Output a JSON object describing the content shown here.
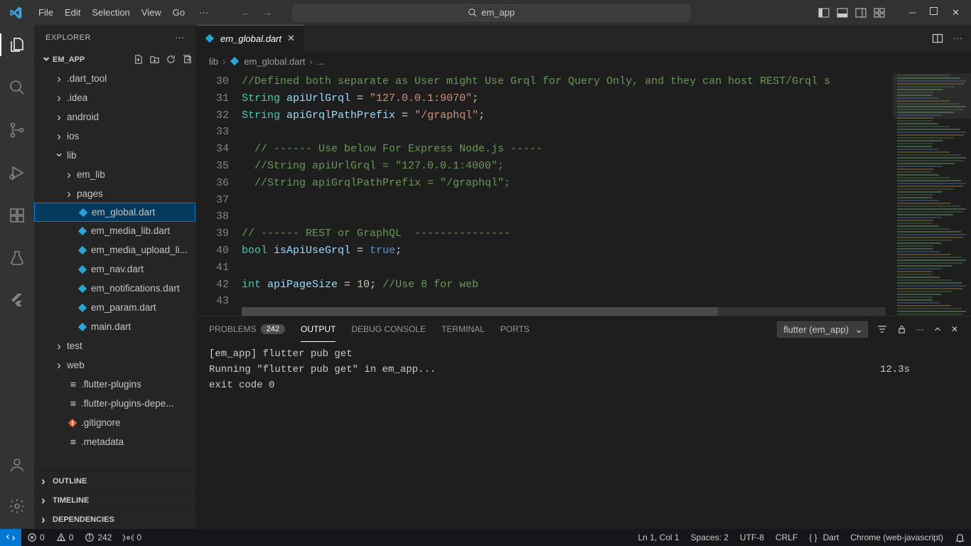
{
  "titlebar": {
    "menus": [
      "File",
      "Edit",
      "Selection",
      "View",
      "Go"
    ],
    "search_placeholder": "em_app"
  },
  "activitybar": {
    "items": [
      "files",
      "search",
      "source-control",
      "debug",
      "extensions",
      "testing",
      "flutter"
    ],
    "bottom": [
      "account",
      "settings-gear"
    ]
  },
  "sidebar": {
    "title": "EXPLORER",
    "project_name": "EM_APP",
    "tree": [
      {
        "label": ".dart_tool",
        "kind": "folder",
        "depth": 1,
        "open": false
      },
      {
        "label": ".idea",
        "kind": "folder",
        "depth": 1,
        "open": false
      },
      {
        "label": "android",
        "kind": "folder",
        "depth": 1,
        "open": false
      },
      {
        "label": "ios",
        "kind": "folder",
        "depth": 1,
        "open": false
      },
      {
        "label": "lib",
        "kind": "folder",
        "depth": 1,
        "open": true
      },
      {
        "label": "em_lib",
        "kind": "folder",
        "depth": 2,
        "open": false
      },
      {
        "label": "pages",
        "kind": "folder",
        "depth": 2,
        "open": false
      },
      {
        "label": "em_global.dart",
        "kind": "dart",
        "depth": 2,
        "selected": true
      },
      {
        "label": "em_media_lib.dart",
        "kind": "dart",
        "depth": 2
      },
      {
        "label": "em_media_upload_li...",
        "kind": "dart",
        "depth": 2
      },
      {
        "label": "em_nav.dart",
        "kind": "dart",
        "depth": 2
      },
      {
        "label": "em_notifications.dart",
        "kind": "dart",
        "depth": 2
      },
      {
        "label": "em_param.dart",
        "kind": "dart",
        "depth": 2
      },
      {
        "label": "main.dart",
        "kind": "dart",
        "depth": 2
      },
      {
        "label": "test",
        "kind": "folder",
        "depth": 1,
        "open": false
      },
      {
        "label": "web",
        "kind": "folder",
        "depth": 1,
        "open": false
      },
      {
        "label": ".flutter-plugins",
        "kind": "file",
        "depth": 1
      },
      {
        "label": ".flutter-plugins-depe...",
        "kind": "file",
        "depth": 1
      },
      {
        "label": ".gitignore",
        "kind": "git",
        "depth": 1
      },
      {
        "label": ".metadata",
        "kind": "file",
        "depth": 1
      }
    ],
    "collapsed_sections": [
      "OUTLINE",
      "TIMELINE",
      "DEPENDENCIES"
    ]
  },
  "editor": {
    "tab_label": "em_global.dart",
    "breadcrumbs": [
      "lib",
      "em_global.dart",
      "..."
    ],
    "first_line_no": 30,
    "lines": [
      {
        "n": 30,
        "segs": [
          {
            "t": "//Defined both separate as User might Use Grql for Query Only, and they can host REST/Grql s",
            "c": "tok-comment"
          }
        ]
      },
      {
        "n": 31,
        "segs": [
          {
            "t": "String ",
            "c": "tok-type"
          },
          {
            "t": "apiUrlGrql",
            "c": "tok-var"
          },
          {
            "t": " = ",
            "c": "tok-op"
          },
          {
            "t": "\"127.0.0.1:9070\"",
            "c": "tok-str"
          },
          {
            "t": ";",
            "c": "tok-op"
          }
        ]
      },
      {
        "n": 32,
        "segs": [
          {
            "t": "String ",
            "c": "tok-type"
          },
          {
            "t": "apiGrqlPathPrefix",
            "c": "tok-var"
          },
          {
            "t": " = ",
            "c": "tok-op"
          },
          {
            "t": "\"/graphql\"",
            "c": "tok-str"
          },
          {
            "t": ";",
            "c": "tok-op"
          }
        ]
      },
      {
        "n": 33,
        "segs": []
      },
      {
        "n": 34,
        "segs": [
          {
            "t": "  // ------ Use below For Express Node.js -----",
            "c": "tok-comment"
          }
        ]
      },
      {
        "n": 35,
        "segs": [
          {
            "t": "  //String apiUrlGrql = \"127.0.0.1:4000\";",
            "c": "tok-comment"
          }
        ]
      },
      {
        "n": 36,
        "segs": [
          {
            "t": "  //String apiGrqlPathPrefix = \"/graphql\";",
            "c": "tok-comment"
          }
        ]
      },
      {
        "n": 37,
        "segs": []
      },
      {
        "n": 38,
        "segs": []
      },
      {
        "n": 39,
        "segs": [
          {
            "t": "// ------ REST or GraphQL  ---------------",
            "c": "tok-comment"
          }
        ]
      },
      {
        "n": 40,
        "segs": [
          {
            "t": "bool ",
            "c": "tok-type"
          },
          {
            "t": "isApiUseGrql",
            "c": "tok-var"
          },
          {
            "t": " = ",
            "c": "tok-op"
          },
          {
            "t": "true",
            "c": "tok-keyword"
          },
          {
            "t": ";",
            "c": "tok-op"
          }
        ]
      },
      {
        "n": 41,
        "segs": []
      },
      {
        "n": 42,
        "segs": [
          {
            "t": "int ",
            "c": "tok-type"
          },
          {
            "t": "apiPageSize",
            "c": "tok-var"
          },
          {
            "t": " = ",
            "c": "tok-op"
          },
          {
            "t": "10",
            "c": "tok-num"
          },
          {
            "t": "; ",
            "c": "tok-op"
          },
          {
            "t": "//Use 8 for web",
            "c": "tok-comment"
          }
        ]
      },
      {
        "n": 43,
        "segs": []
      }
    ]
  },
  "panel": {
    "tabs": {
      "problems": "PROBLEMS",
      "problems_badge": "242",
      "output": "OUTPUT",
      "debug": "DEBUG CONSOLE",
      "terminal": "TERMINAL",
      "ports": "PORTS"
    },
    "dropdown": "flutter (em_app)",
    "output_lines": [
      {
        "lhs": "[em_app] flutter pub get",
        "rhs": ""
      },
      {
        "lhs": "Running \"flutter pub get\" in em_app...",
        "rhs": "12.3s"
      },
      {
        "lhs": "exit code 0",
        "rhs": ""
      }
    ]
  },
  "statusbar": {
    "errors": "0",
    "warnings": "0",
    "info": "242",
    "radio": "0",
    "ln_col": "Ln 1, Col 1",
    "spaces": "Spaces: 2",
    "encoding": "UTF-8",
    "eol": "CRLF",
    "language": "Dart",
    "target": "Chrome (web-javascript)"
  }
}
